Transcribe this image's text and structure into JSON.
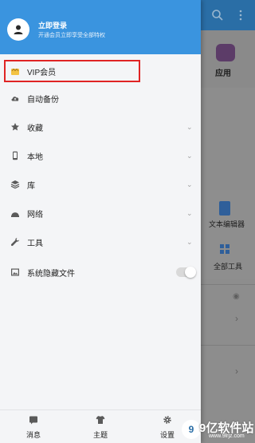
{
  "background_app": {
    "app_label": "应用",
    "text_editor_label": "文本编辑器",
    "all_tools_label": "全部工具",
    "icons": [
      "search-icon",
      "more-icon",
      "android-icon",
      "document-icon",
      "grid-icon",
      "eye-icon",
      "chevron-right-icon"
    ]
  },
  "drawer": {
    "header": {
      "title": "立即登录",
      "subtitle": "开通会员立即享受全部特权",
      "color": "#3a94df"
    },
    "items": [
      {
        "label": "VIP会员",
        "icon": "vip-crown-icon",
        "highlighted": true
      },
      {
        "label": "自动备份",
        "icon": "cloud-upload-icon"
      },
      {
        "label": "收藏",
        "icon": "star-icon",
        "chevron": true
      },
      {
        "label": "本地",
        "icon": "phone-icon",
        "chevron": true
      },
      {
        "label": "库",
        "icon": "stack-icon",
        "chevron": true
      },
      {
        "label": "网络",
        "icon": "network-icon",
        "chevron": true
      },
      {
        "label": "工具",
        "icon": "wrench-icon",
        "chevron": true
      },
      {
        "label": "系统隐藏文件",
        "icon": "image-icon",
        "toggle": false
      }
    ],
    "bottom": [
      {
        "label": "消息",
        "icon": "message-icon"
      },
      {
        "label": "主题",
        "icon": "tshirt-icon"
      },
      {
        "label": "设置",
        "icon": "gear-icon"
      }
    ]
  },
  "watermark": {
    "main": "9亿软件站",
    "sub": "www.9lrjz.com"
  }
}
